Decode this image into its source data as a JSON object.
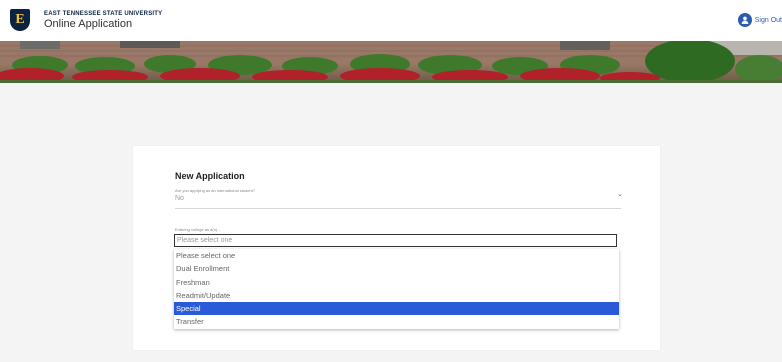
{
  "header": {
    "university": "EAST TENNESSEE STATE UNIVERSITY",
    "app_title": "Online Application",
    "logo_letter": "E",
    "sign_out_label": "Sign Out"
  },
  "form": {
    "title": "New Application",
    "international": {
      "label": "Are you applying as an international student?",
      "value": "No"
    },
    "entering_college": {
      "label": "Entering college as a(n)...",
      "placeholder": "Please select one",
      "options": [
        "Please select one",
        "Dual Enrollment",
        "Freshman",
        "Readmit/Update",
        "Special",
        "Transfer"
      ],
      "highlighted_index": 4
    }
  },
  "colors": {
    "brand_navy": "#0b2341",
    "brand_gold": "#f4c430",
    "link_blue": "#2a5db0",
    "highlight_blue": "#2a5ad7"
  }
}
